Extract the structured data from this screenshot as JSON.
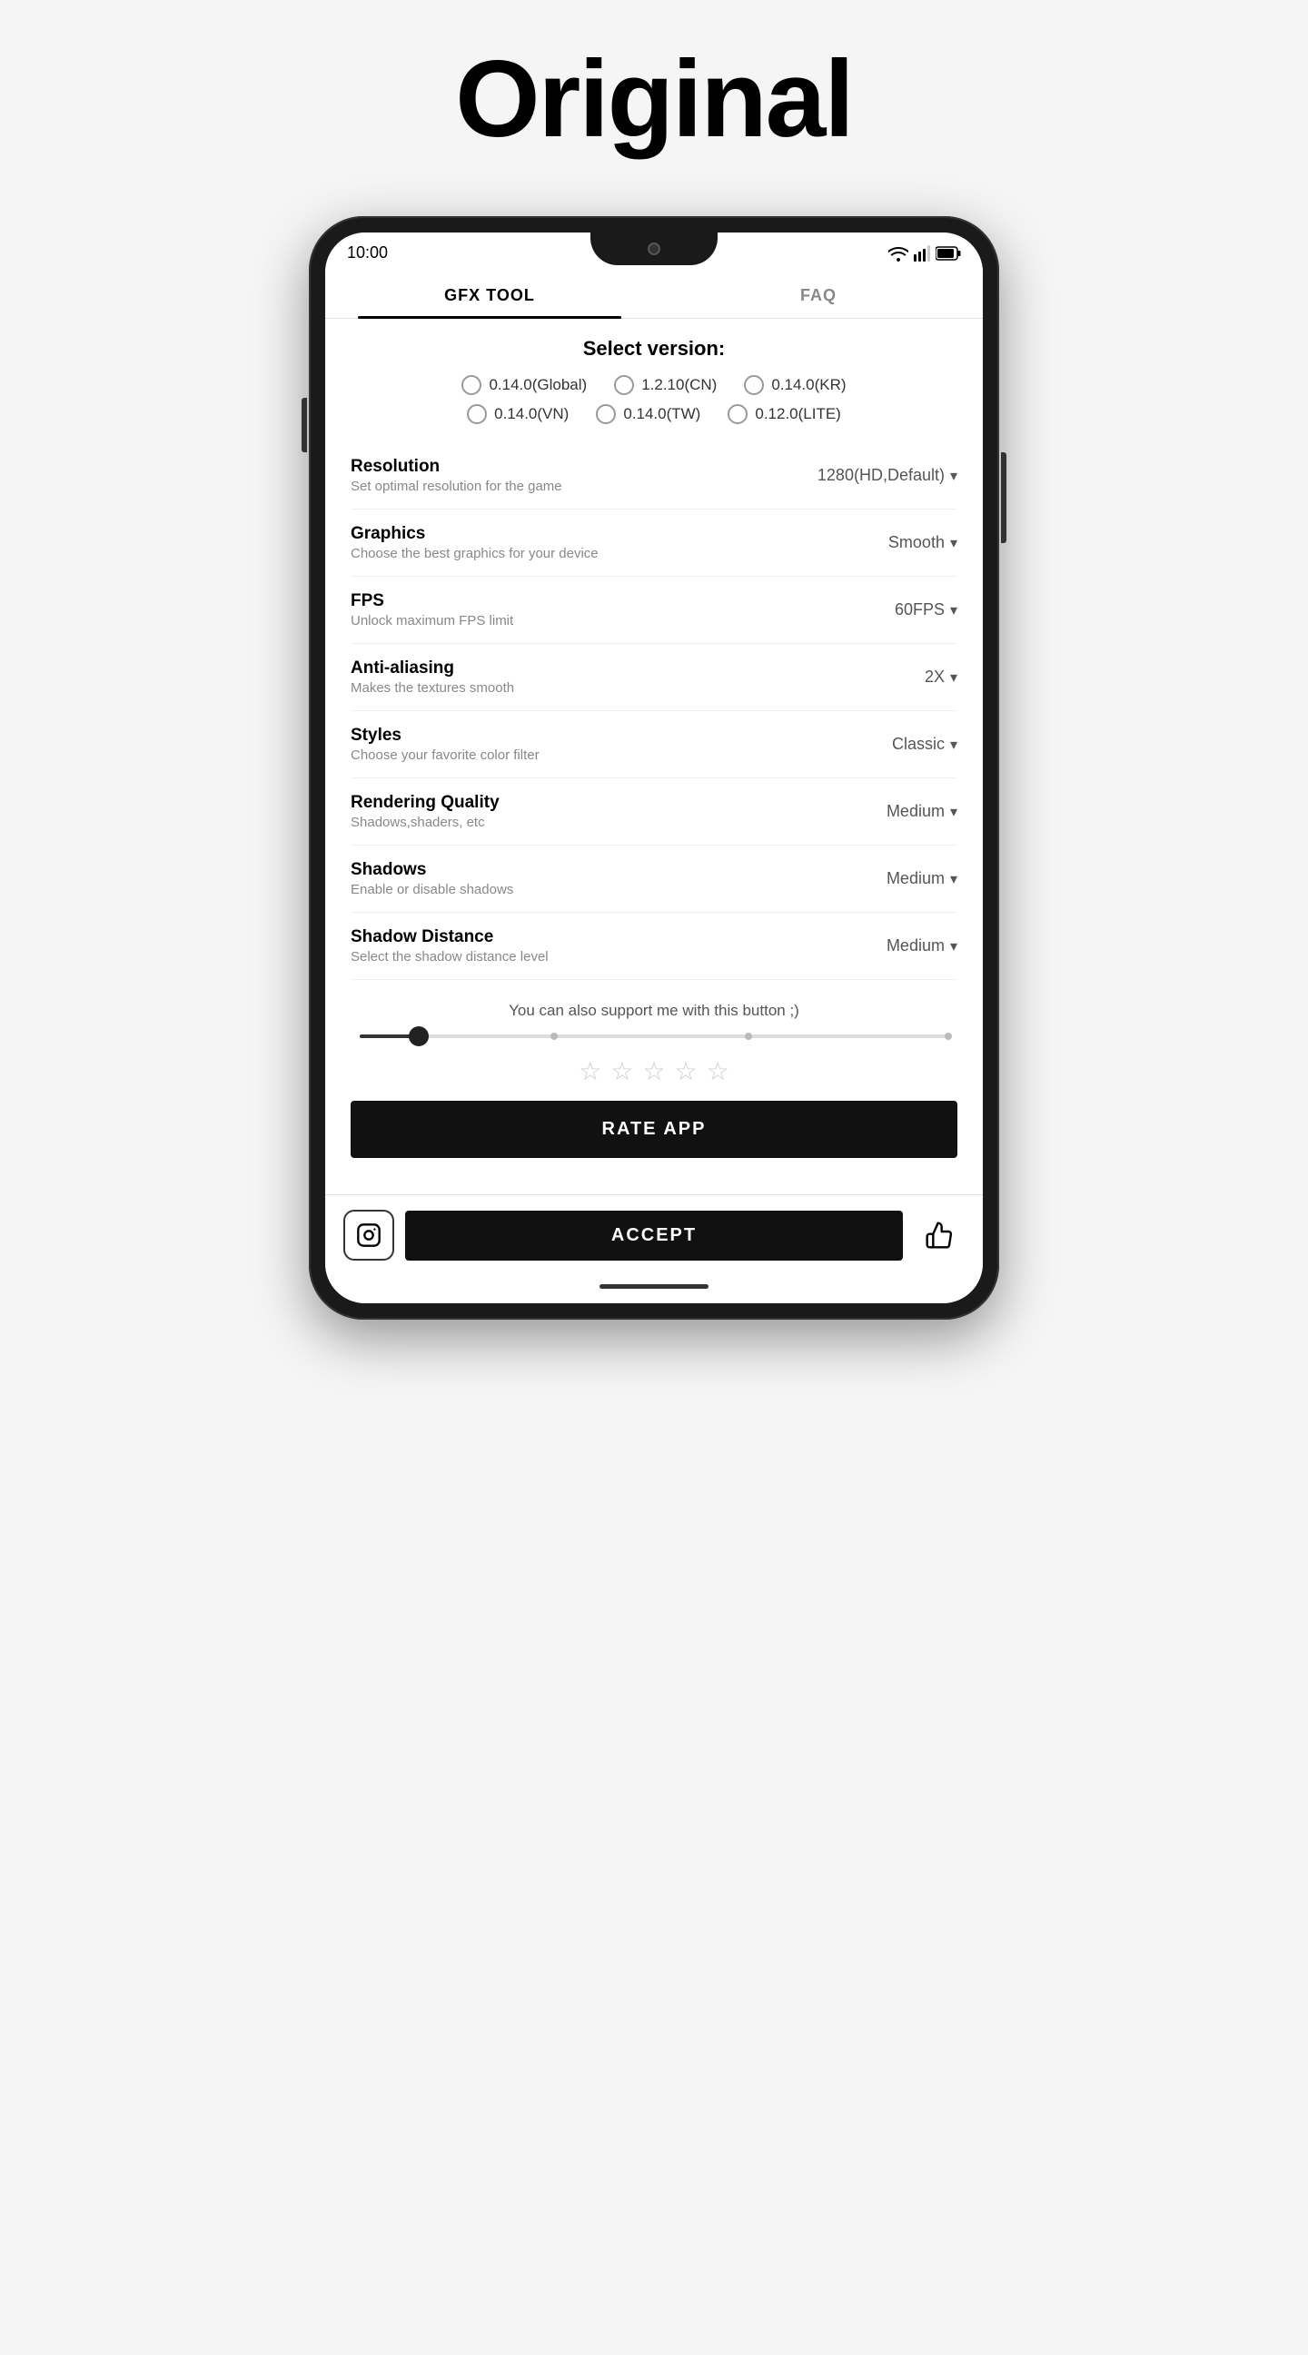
{
  "page": {
    "title": "Original"
  },
  "tabs": [
    {
      "id": "gfx",
      "label": "GFX TOOL",
      "active": true
    },
    {
      "id": "faq",
      "label": "FAQ",
      "active": false
    }
  ],
  "version_selector": {
    "heading": "Select version:",
    "options": [
      {
        "label": "0.14.0(Global)"
      },
      {
        "label": "1.2.10(CN)"
      },
      {
        "label": "0.14.0(KR)"
      },
      {
        "label": "0.14.0(VN)"
      },
      {
        "label": "0.14.0(TW)"
      },
      {
        "label": "0.12.0(LITE)"
      }
    ]
  },
  "settings": [
    {
      "id": "resolution",
      "label": "Resolution",
      "desc": "Set optimal resolution for the game",
      "value": "1280(HD,Default)"
    },
    {
      "id": "graphics",
      "label": "Graphics",
      "desc": "Choose the best graphics for your device",
      "value": "Smooth"
    },
    {
      "id": "fps",
      "label": "FPS",
      "desc": "Unlock maximum FPS limit",
      "value": "60FPS"
    },
    {
      "id": "antialiasing",
      "label": "Anti-aliasing",
      "desc": "Makes the textures smooth",
      "value": "2X"
    },
    {
      "id": "styles",
      "label": "Styles",
      "desc": "Choose your favorite color filter",
      "value": "Classic"
    },
    {
      "id": "rendering-quality",
      "label": "Rendering Quality",
      "desc": "Shadows,shaders, etc",
      "value": "Medium"
    },
    {
      "id": "shadows",
      "label": "Shadows",
      "desc": "Enable or disable shadows",
      "value": "Medium"
    },
    {
      "id": "shadow-distance",
      "label": "Shadow Distance",
      "desc": "Select the shadow distance level",
      "value": "Medium"
    }
  ],
  "support_text": "You can also support me with this button ;)",
  "rate_app_label": "RATE APP",
  "accept_label": "ACCEPT",
  "status_bar": {
    "time": "10:00"
  }
}
